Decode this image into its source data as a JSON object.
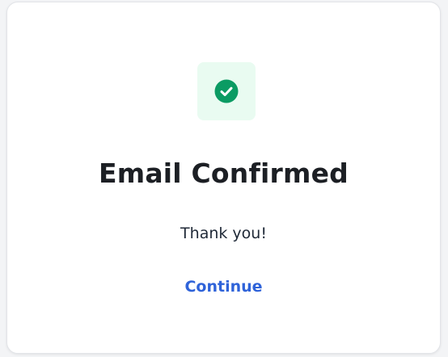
{
  "confirmation": {
    "icon": "check-circle-icon",
    "title": "Email Confirmed",
    "message": "Thank you!",
    "continue_label": "Continue"
  },
  "colors": {
    "success": "#0b9b63",
    "success_tile": "#e9fbf1",
    "link": "#2f63d9",
    "heading": "#1c1f24"
  }
}
